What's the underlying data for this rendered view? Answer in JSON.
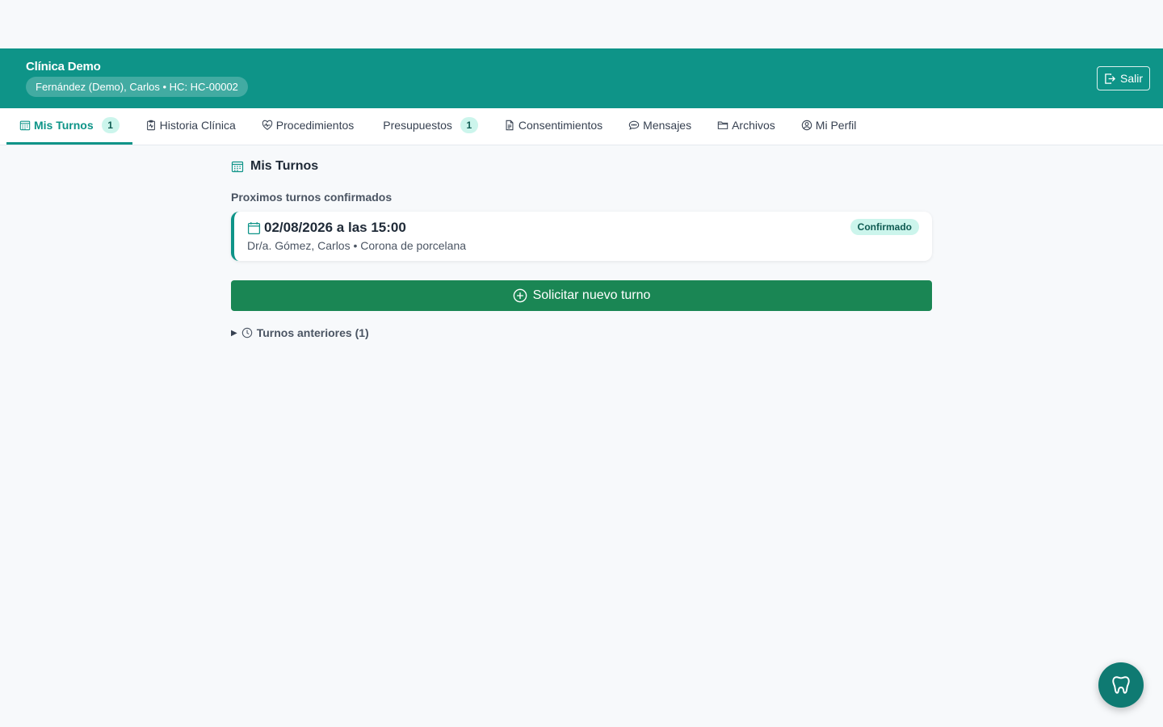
{
  "header": {
    "clinic_name": "Clínica Demo",
    "patient_info": "Fernández (Demo), Carlos • HC: HC-00002",
    "logout_label": "Salir"
  },
  "tabs": [
    {
      "label": "Mis Turnos",
      "badge": "1",
      "icon": "calendar-grid-icon",
      "active": true
    },
    {
      "label": "Historia Clínica",
      "icon": "clipboard-pulse-icon"
    },
    {
      "label": "Procedimientos",
      "icon": "heart-pulse-icon"
    },
    {
      "label": "Presupuestos",
      "badge": "1"
    },
    {
      "label": "Consentimientos",
      "icon": "document-icon"
    },
    {
      "label": "Mensajes",
      "icon": "chat-icon"
    },
    {
      "label": "Archivos",
      "icon": "folder-icon"
    },
    {
      "label": "Mi Perfil",
      "icon": "user-circle-icon"
    }
  ],
  "main": {
    "title": "Mis Turnos",
    "subheading": "Proximos turnos confirmados",
    "appointments": [
      {
        "datetime": "02/08/2026 a las 15:00",
        "detail": "Dr/a. Gómez, Carlos • Corona de porcelana",
        "status": "Confirmado"
      }
    ],
    "request_button": "Solicitar nuevo turno",
    "past_toggle": "Turnos anteriores (1)"
  },
  "colors": {
    "brand": "#0e9488",
    "primary_button": "#1a8654",
    "badge_bg": "#ccf5ec",
    "fab": "#0f7a72"
  },
  "fab_icon": "tooth-icon"
}
